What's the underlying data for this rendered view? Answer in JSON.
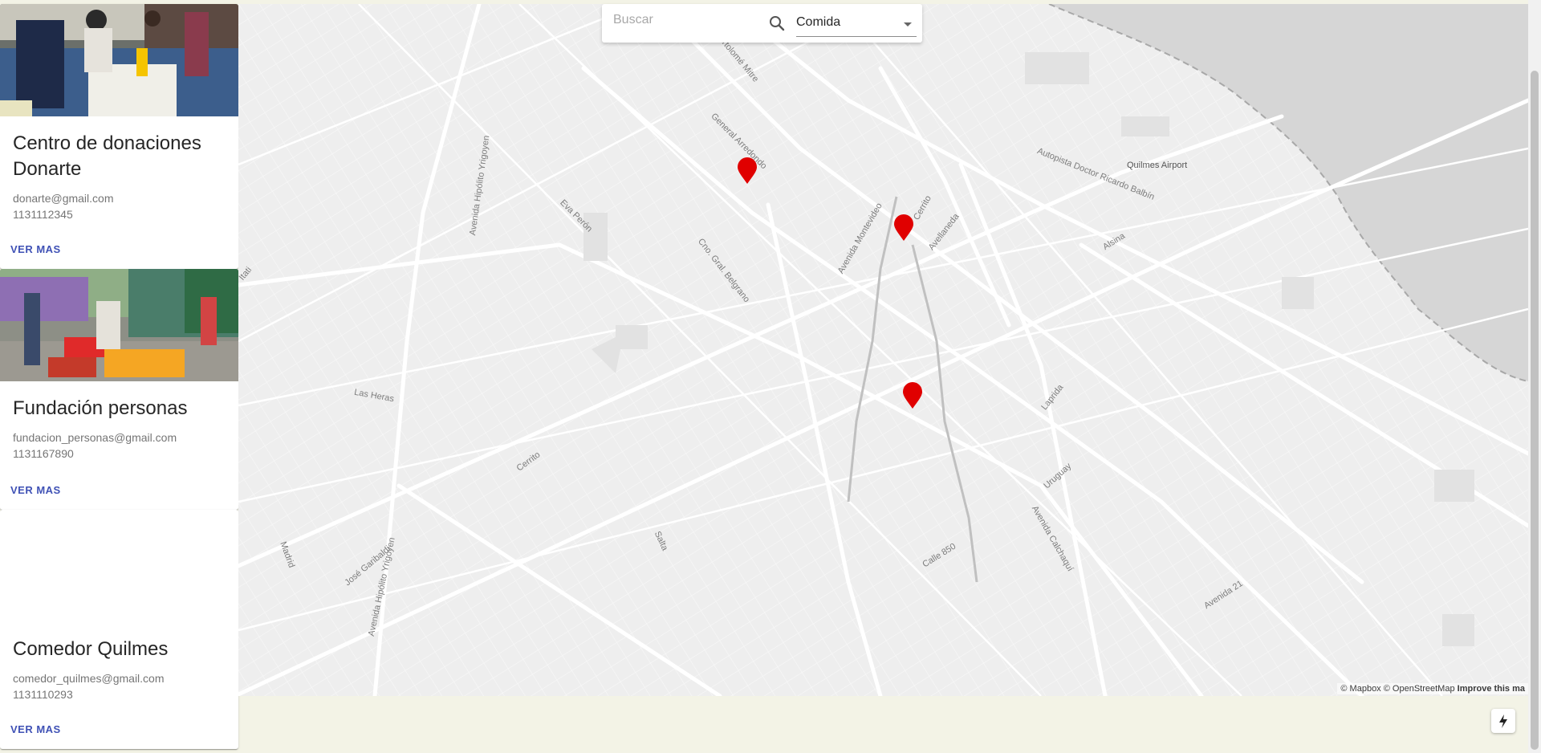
{
  "cards": [
    {
      "title": "Centro de donaciones Donarte",
      "email": "donarte@gmail.com",
      "phone": "1131112345",
      "link": "VER MAS"
    },
    {
      "title": "Fundación personas",
      "email": "fundacion_personas@gmail.com",
      "phone": "1131167890",
      "link": "VER MAS"
    },
    {
      "title": "Comedor Quilmes",
      "email": "comedor_quilmes@gmail.com",
      "phone": "1131110293",
      "link": "VER MAS"
    }
  ],
  "search": {
    "placeholder": "Buscar",
    "category": "Comida"
  },
  "map": {
    "labels": [
      "Bartolomé Mitre",
      "General Arredondo",
      "Eva Perón",
      "Avenida Hipólito Yrigoyen",
      "Cno. Gral. Belgrano",
      "Avenida Montevideo",
      "Cerrito",
      "Avellaneda",
      "Autopista Doctor Ricardo Balbín",
      "Quilmes Airport",
      "Alsina",
      "Las Heras",
      "Cerrito",
      "Laprida",
      "Uruguay",
      "Avenida Calchaquí",
      "Calle 850",
      "Salta",
      "José Garibaldi",
      "Madrid",
      "Avenida Hipólito Yrigoyen",
      "Avenida 21",
      "Itati"
    ],
    "marker_color": "#e00000",
    "attribution_mapbox": "© Mapbox",
    "attribution_osm": "© OpenStreetMap",
    "attribution_improve": "Improve this ma"
  }
}
